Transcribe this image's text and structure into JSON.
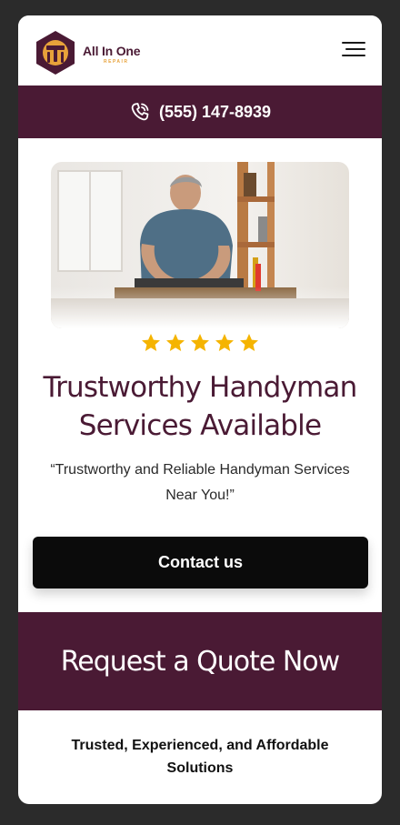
{
  "header": {
    "logo_name": "All In One",
    "logo_sub": "REPAIR",
    "menu_icon": "hamburger-menu-icon"
  },
  "phone_bar": {
    "icon": "phone-call-icon",
    "number": "(555) 147-8939"
  },
  "hero": {
    "image_icon": "handyman-photo",
    "rating_stars": 5,
    "title_line1": "Trustworthy Handyman",
    "title_line2": "Services Available",
    "quote_line1": "“Trustworthy and Reliable Handyman Services",
    "quote_line2": "Near You!”",
    "contact_label": "Contact us"
  },
  "quote_section": {
    "title": "Request a Quote Now"
  },
  "tagline": {
    "line1": "Trusted, Experienced, and Affordable",
    "line2": "Solutions"
  },
  "colors": {
    "brand": "#4a1a34",
    "accent": "#e7a23a",
    "star": "#f5b400",
    "button": "#0b0b0b"
  }
}
